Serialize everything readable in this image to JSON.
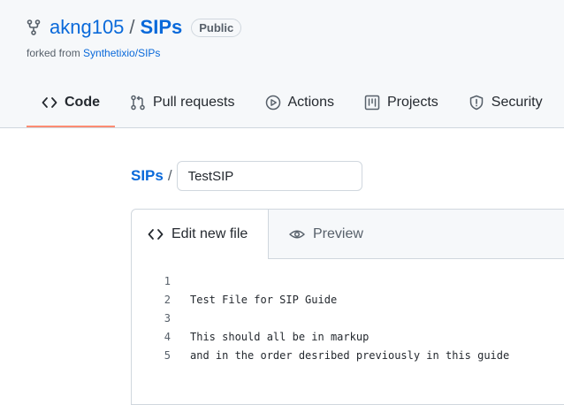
{
  "repo": {
    "owner": "akng105",
    "separator": "/",
    "name": "SIPs",
    "visibility": "Public",
    "forked_prefix": "forked from ",
    "forked_source": "Synthetixio/SIPs"
  },
  "nav": {
    "tabs": [
      {
        "label": "Code",
        "icon": "code-icon",
        "selected": true
      },
      {
        "label": "Pull requests",
        "icon": "pull-request-icon",
        "selected": false
      },
      {
        "label": "Actions",
        "icon": "play-icon",
        "selected": false
      },
      {
        "label": "Projects",
        "icon": "project-icon",
        "selected": false
      },
      {
        "label": "Security",
        "icon": "shield-icon",
        "selected": false
      }
    ]
  },
  "path": {
    "crumb": "SIPs",
    "separator": "/",
    "filename_value": "TestSIP"
  },
  "editor": {
    "edit_tab": "Edit new file",
    "preview_tab": "Preview",
    "lines": [
      {
        "number": "1",
        "text": ""
      },
      {
        "number": "2",
        "text": "Test File for SIP Guide"
      },
      {
        "number": "3",
        "text": ""
      },
      {
        "number": "4",
        "text": "This should all be in markup"
      },
      {
        "number": "5",
        "text": "and in the order desribed previously in this guide"
      }
    ]
  },
  "colors": {
    "link": "#0969da",
    "selected_underline": "#fd8c73",
    "muted": "#57606a"
  }
}
